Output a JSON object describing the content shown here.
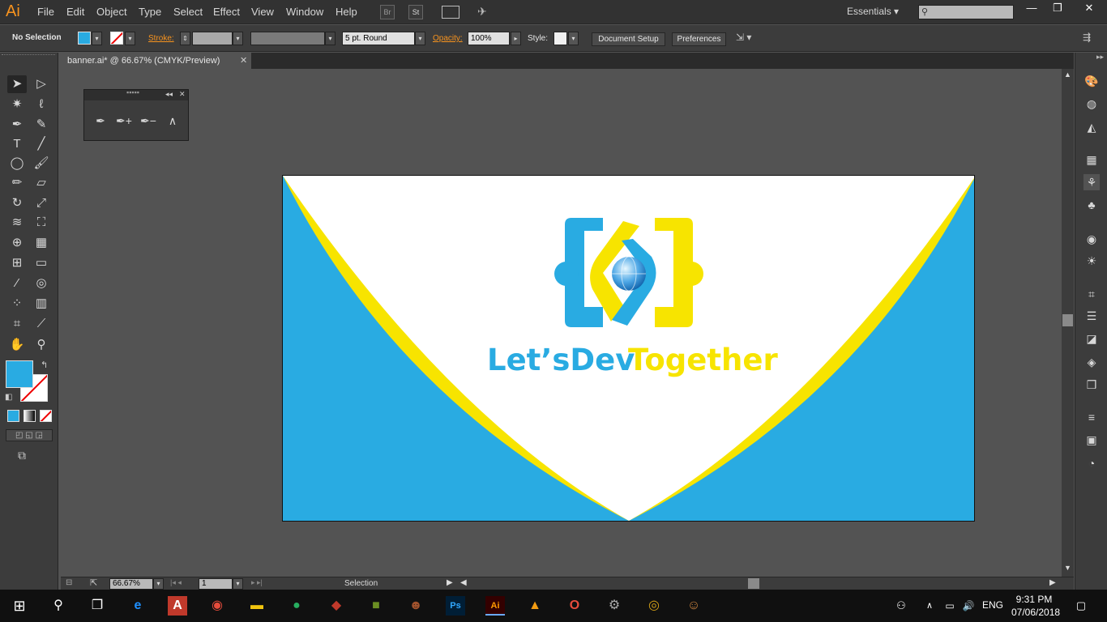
{
  "app": {
    "logo": "Ai"
  },
  "menu": [
    "File",
    "Edit",
    "Object",
    "Type",
    "Select",
    "Effect",
    "View",
    "Window",
    "Help"
  ],
  "menubar_buttons": {
    "bridge": "Br",
    "stock": "St"
  },
  "workspace": "Essentials",
  "control": {
    "selection": "No Selection",
    "stroke_label": "Stroke:",
    "brush": "5 pt. Round",
    "opacity_label": "Opacity:",
    "opacity": "100%",
    "style_label": "Style:",
    "document_setup": "Document Setup",
    "preferences": "Preferences"
  },
  "document": {
    "tab_title": "banner.ai* @ 66.67% (CMYK/Preview)"
  },
  "status": {
    "zoom": "66.67%",
    "page": "1",
    "tool": "Selection"
  },
  "artwork": {
    "brand_part1": "Let’sDev",
    "brand_part2": "Together",
    "colors": {
      "blue": "#29abe2",
      "yellow": "#f7e400",
      "white": "#ffffff"
    }
  },
  "taskbar": {
    "time": "9:31 PM",
    "date": "07/06/2018",
    "lang": "ENG"
  }
}
